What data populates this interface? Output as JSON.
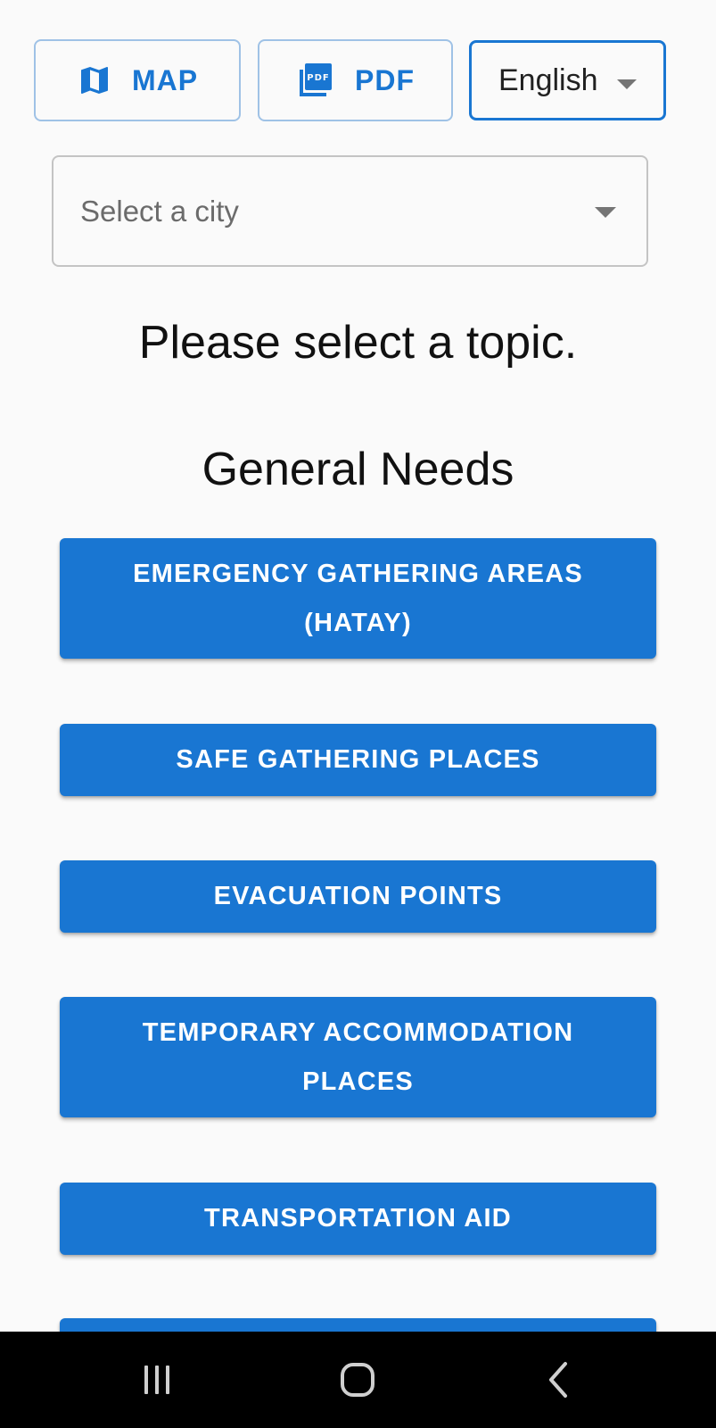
{
  "header": {
    "map_button": {
      "label": "MAP",
      "icon": "map-icon"
    },
    "pdf_button": {
      "label": "PDF",
      "icon": "pdf-icon"
    },
    "language_select": {
      "value": "English",
      "icon": "caret-down-icon"
    }
  },
  "city_select": {
    "placeholder": "Select a city",
    "icon": "caret-down-icon"
  },
  "main": {
    "prompt": "Please select a topic.",
    "section_title": "General Needs",
    "topics": [
      {
        "line1": "EMERGENCY GATHERING AREAS",
        "line2": "(HATAY)"
      },
      {
        "line1": "SAFE GATHERING PLACES",
        "line2": ""
      },
      {
        "line1": "EVACUATION POINTS",
        "line2": ""
      },
      {
        "line1": "TEMPORARY ACCOMMODATION",
        "line2": "PLACES"
      },
      {
        "line1": "TRANSPORTATION AID",
        "line2": ""
      },
      {
        "line1": "",
        "line2": ""
      }
    ]
  },
  "nav_bar": {
    "recents_icon": "recents-icon",
    "home_icon": "home-icon",
    "back_icon": "back-icon"
  },
  "colors": {
    "accent": "#1976d2",
    "outline": "#9fc2e6",
    "background": "#fafafa",
    "nav_bar": "#000000"
  }
}
